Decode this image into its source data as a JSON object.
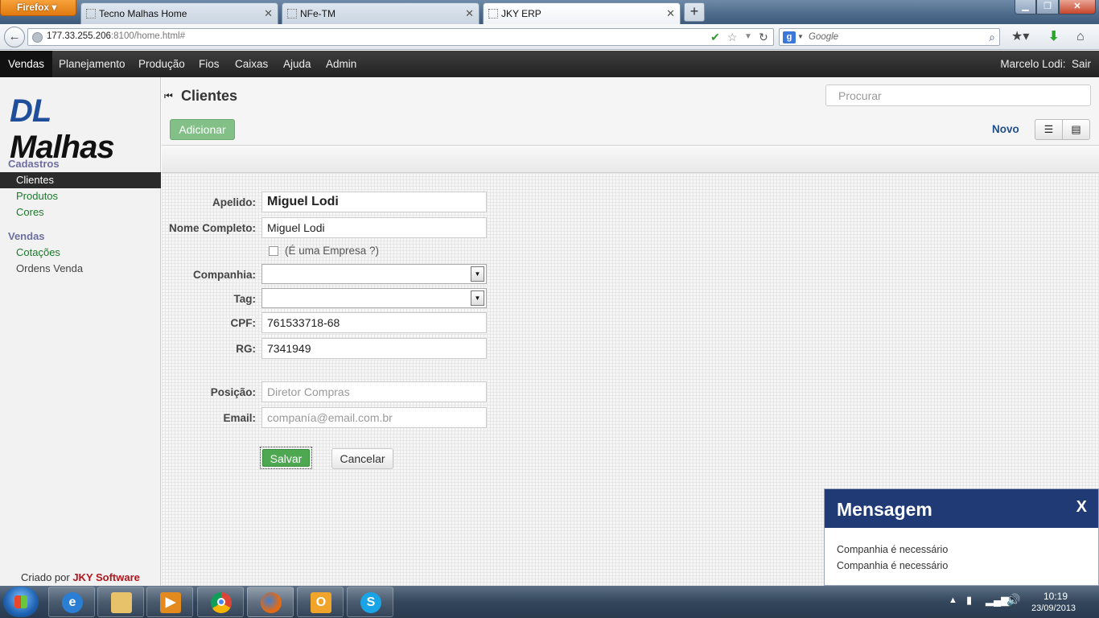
{
  "browser": {
    "menu_button": "Firefox",
    "tabs": [
      {
        "label": "Tecno Malhas Home"
      },
      {
        "label": "NFe-TM"
      },
      {
        "label": "JKY ERP"
      }
    ],
    "url_host": "177.33.255.206",
    "url_rest": ":8100/home.html#",
    "search_placeholder": "Google"
  },
  "app_menu": {
    "items": [
      "Vendas",
      "Planejamento",
      "Produção",
      "Fios",
      "Caixas",
      "Ajuda",
      "Admin"
    ],
    "user_name": "Marcelo Lodi:",
    "logout": "Sair"
  },
  "sidebar": {
    "logo_dl": "DL",
    "logo_malhas": "Malhas",
    "sections": [
      {
        "title": "Cadastros",
        "items": [
          "Clientes",
          "Produtos",
          "Cores"
        ]
      },
      {
        "title": "Vendas",
        "items": [
          "Cotações",
          "Ordens Venda"
        ]
      }
    ],
    "credits_prefix": "Criado por",
    "credits_brand": "JKY Software"
  },
  "header": {
    "title": "Clientes",
    "search_placeholder": "Procurar",
    "add_button": "Adicionar",
    "mode_label": "Novo"
  },
  "form": {
    "apelido_label": "Apelido:",
    "apelido_value": "Miguel Lodi",
    "nome_label": "Nome Completo:",
    "nome_value": "Miguel Lodi",
    "empresa_label": "(É uma Empresa ?)",
    "companhia_label": "Companhia:",
    "companhia_value": "",
    "tag_label": "Tag:",
    "tag_value": "",
    "cpf_label": "CPF:",
    "cpf_value": "761533718-68",
    "rg_label": "RG:",
    "rg_value": "7341949",
    "posicao_label": "Posição:",
    "posicao_placeholder": "Diretor Compras",
    "email_label": "Email:",
    "email_placeholder": "companía@email.com.br",
    "save_button": "Salvar",
    "cancel_button": "Cancelar"
  },
  "message": {
    "title": "Mensagem",
    "close": "X",
    "lines": [
      "Companhia é necessário",
      "Companhia é necessário"
    ]
  },
  "taskbar": {
    "time": "10:19",
    "date": "23/09/2013"
  }
}
